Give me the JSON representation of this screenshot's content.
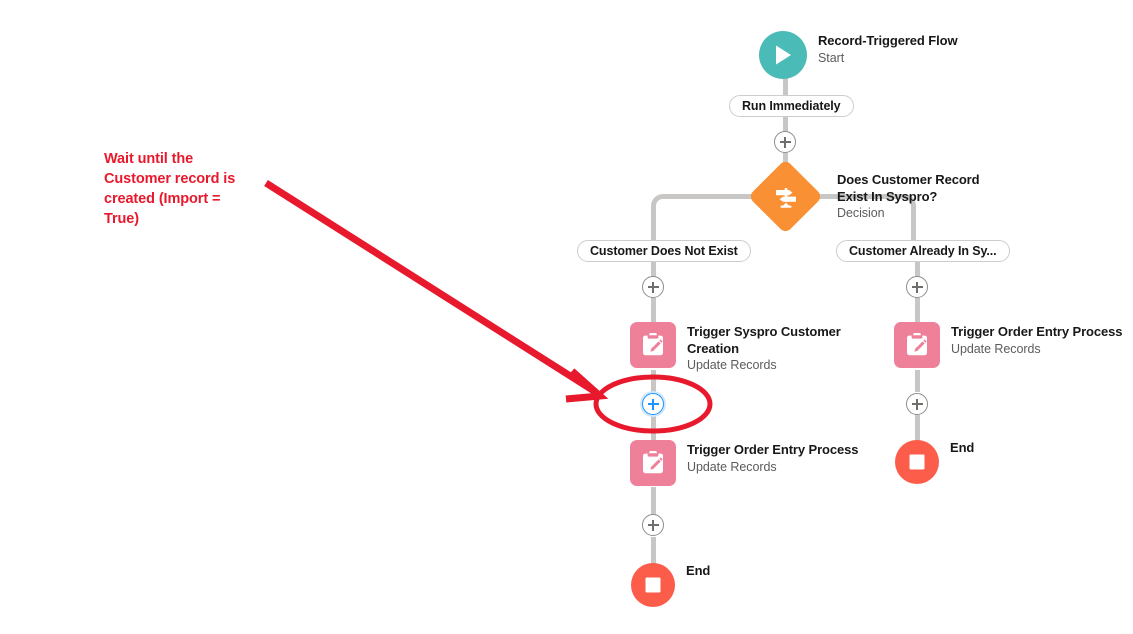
{
  "diagram": {
    "type": "salesforce-flow-builder-canvas",
    "background": "#ffffff"
  },
  "colors": {
    "start_teal": "#4BBBB8",
    "decision_orange": "#F99033",
    "update_pink": "#EE8099",
    "end_red": "#FB5D4A",
    "connector_gray": "#C9C7C5",
    "annotation_red": "#E8192C",
    "focus_blue": "#1B96FF"
  },
  "nodes": {
    "start": {
      "title": "Record-Triggered Flow",
      "subtitle": "Start",
      "icon": "play-icon"
    },
    "decision": {
      "title": "Does Customer Record Exist In Syspro?",
      "subtitle": "Decision",
      "icon": "signpost-icon"
    },
    "update_left": {
      "title": "Trigger Syspro Customer Creation",
      "subtitle": "Update Records",
      "icon": "clipboard-pencil-icon"
    },
    "update_left_second": {
      "title": "Trigger Order Entry Process",
      "subtitle": "Update Records",
      "icon": "clipboard-pencil-icon"
    },
    "update_right": {
      "title": "Trigger Order Entry Process",
      "subtitle": "Update Records",
      "icon": "clipboard-pencil-icon"
    },
    "end_left": {
      "title": "End",
      "icon": "stop-square-icon"
    },
    "end_right": {
      "title": "End",
      "icon": "stop-square-icon"
    }
  },
  "connectors": {
    "run_immediately": "Run Immediately",
    "branch_left": "Customer Does Not Exist",
    "branch_right": "Customer Already In Sy..."
  },
  "add_buttons": {
    "label": "+",
    "after_start": "add-element",
    "branch_left": "add-element",
    "branch_right": "add-element",
    "after_update_left": "add-element",
    "after_update_left_second": "add-element",
    "after_update_right": "add-element"
  },
  "annotation": {
    "text": "Wait until the Customer record is created (Import = True)",
    "arrow": "red-arrow-pointing-to-add-button",
    "highlight": "red-ellipse-around-add-button"
  }
}
